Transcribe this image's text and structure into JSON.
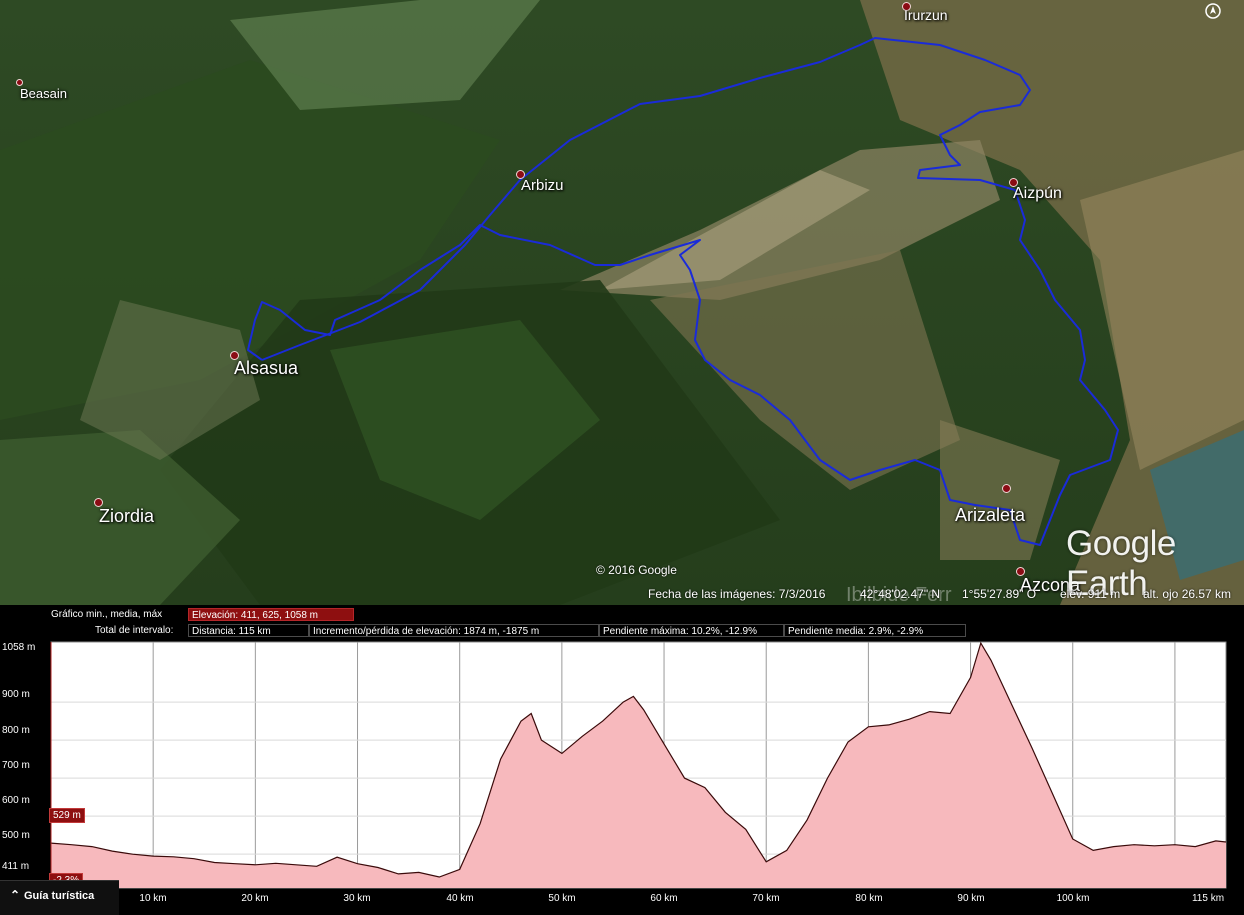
{
  "map": {
    "places": [
      {
        "name": "Irurzun",
        "size": 14
      },
      {
        "name": "Beasain",
        "size": 13
      },
      {
        "name": "Arbizu",
        "size": 15
      },
      {
        "name": "Aizpún",
        "size": 16
      },
      {
        "name": "Alsasua",
        "size": 18
      },
      {
        "name": "Ziordia",
        "size": 18
      },
      {
        "name": "Arizaleta",
        "size": 18
      },
      {
        "name": "Azcona",
        "size": 18
      }
    ],
    "logo": "Google Earth",
    "copyright": "© 2016 Google",
    "faded_label": "Ibilbide Ferr",
    "status": {
      "date": "Fecha de las imágenes: 7/3/2016",
      "lat": "42°48'02.47\" N",
      "lon": "1°55'27.89\" O",
      "elev": "elev.   911 m",
      "eye_alt": "alt. ojo   26.57 km"
    },
    "route_color": "#1a2bd9",
    "icons": [
      "compass-icon",
      "place-pin-icon"
    ]
  },
  "profile": {
    "graph_label": "Gráfico  min., media, máx",
    "elevation_box": "Elevación: 411, 625, 1058 m",
    "interval_label": "Total de intervalo:",
    "distance_box": "Distancia: 115 km",
    "gain_box": "Incremento/pérdida de elevación: 1874 m, -1875 m",
    "max_slope_box": "Pendiente máxima: 10.2%, -12.9%",
    "avg_slope_box": "Pendiente media: 2.9%, -2.9%",
    "y_labels": [
      "1058 m",
      "900 m",
      "800 m",
      "700 m",
      "600 m",
      "500 m",
      "411 m"
    ],
    "x_labels": [
      "10 km",
      "20 km",
      "30 km",
      "40 km",
      "50 km",
      "60 km",
      "70 km",
      "80 km",
      "90 km",
      "100 km",
      "115 km"
    ],
    "cursor_elev": "529 m",
    "cursor_slope": "-2.3%",
    "guide_label": "Guía turística",
    "fill_color": "#f7b9bd",
    "line_color": "#3a0a0a"
  },
  "chart_data": {
    "type": "area",
    "xlabel": "",
    "ylabel": "",
    "ylim": [
      411,
      1058
    ],
    "xlim": [
      0,
      115
    ],
    "x": [
      0,
      2,
      4,
      6,
      8,
      10,
      12,
      14,
      16,
      18,
      20,
      22,
      24,
      26,
      28,
      30,
      32,
      34,
      36,
      38,
      40,
      42,
      44,
      46,
      47,
      48,
      50,
      52,
      54,
      56,
      57,
      58,
      60,
      62,
      64,
      66,
      68,
      70,
      72,
      74,
      76,
      78,
      80,
      82,
      84,
      86,
      88,
      90,
      91,
      92,
      94,
      96,
      98,
      100,
      102,
      104,
      106,
      108,
      110,
      112,
      114,
      115
    ],
    "y": [
      529,
      525,
      520,
      508,
      500,
      495,
      493,
      488,
      478,
      475,
      472,
      476,
      472,
      468,
      492,
      475,
      465,
      448,
      452,
      440,
      460,
      580,
      750,
      850,
      870,
      800,
      765,
      810,
      850,
      900,
      915,
      880,
      790,
      700,
      675,
      610,
      565,
      480,
      510,
      590,
      700,
      795,
      835,
      840,
      855,
      875,
      870,
      965,
      1055,
      1010,
      895,
      780,
      660,
      540,
      510,
      520,
      525,
      522,
      525,
      520,
      535,
      532
    ]
  }
}
